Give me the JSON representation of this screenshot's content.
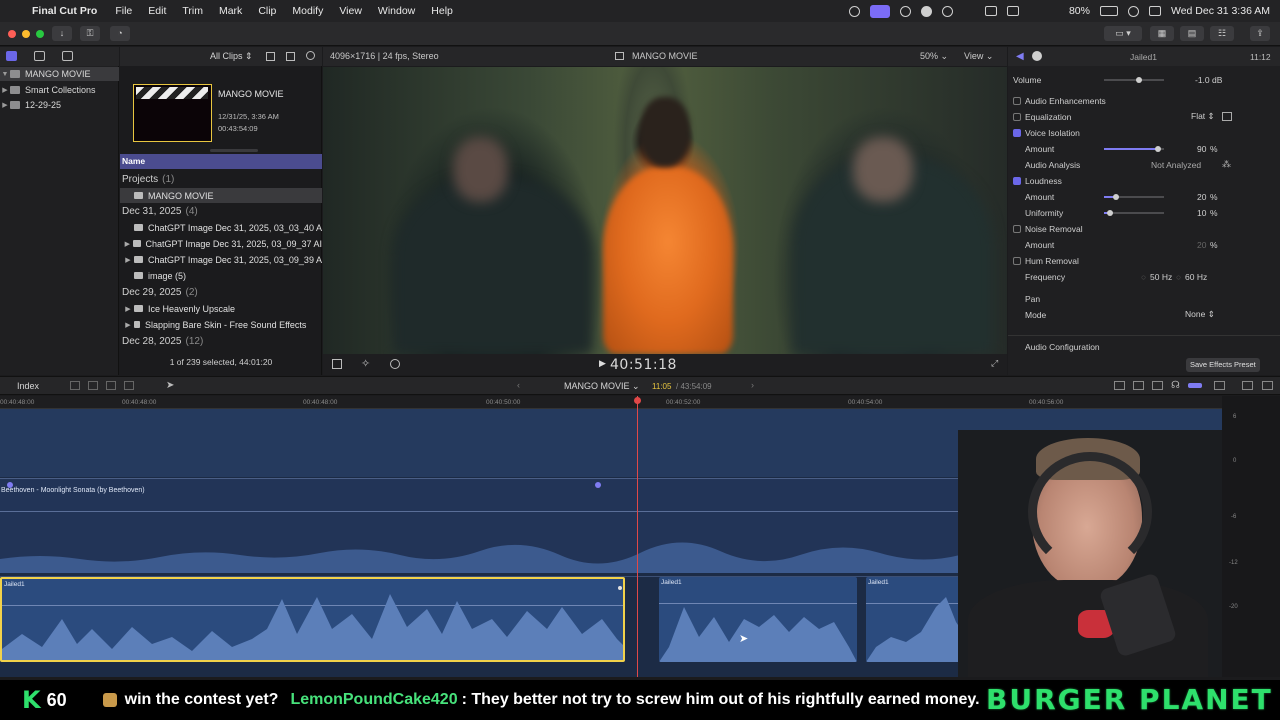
{
  "menubar": {
    "app_name": "Final Cut Pro",
    "items": [
      "File",
      "Edit",
      "Trim",
      "Mark",
      "Clip",
      "Modify",
      "View",
      "Window",
      "Help"
    ],
    "battery": "80%",
    "datetime": "Wed Dec 31  3:36 AM"
  },
  "browser": {
    "filter": "All Clips",
    "library": "MANGO MOVIE",
    "sidebar": [
      "MANGO MOVIE",
      "Smart Collections",
      "12-29-25"
    ],
    "preview": {
      "title": "MANGO MOVIE",
      "date": "12/31/25, 3:36 AM",
      "duration": "00:43:54:09"
    },
    "column_header": "Name",
    "rows": [
      {
        "type": "group",
        "label": "Projects",
        "count": "(1)"
      },
      {
        "type": "item",
        "label": "MANGO MOVIE",
        "selected": true
      },
      {
        "type": "group",
        "label": "Dec 31, 2025",
        "count": "(4)"
      },
      {
        "type": "item",
        "label": "ChatGPT Image Dec 31, 2025, 03_03_40 A"
      },
      {
        "type": "item",
        "label": "ChatGPT Image Dec 31, 2025, 03_09_37 AI",
        "expand": true
      },
      {
        "type": "item",
        "label": "ChatGPT Image Dec 31, 2025, 03_09_39 A",
        "expand": true
      },
      {
        "type": "item",
        "label": "image (5)"
      },
      {
        "type": "group",
        "label": "Dec 29, 2025",
        "count": "(2)"
      },
      {
        "type": "item",
        "label": "Ice Heavenly Upscale",
        "expand": true
      },
      {
        "type": "item",
        "label": "Slapping Bare Skin - Free Sound Effects",
        "expand": true
      },
      {
        "type": "group",
        "label": "Dec 28, 2025",
        "count": "(12)"
      }
    ],
    "status": "1 of 239 selected, 44:01:20"
  },
  "viewer": {
    "format": "4096×1716 | 24 fps, Stereo",
    "title": "MANGO MOVIE",
    "zoom": "50%",
    "view_label": "View",
    "timecode": "40:51:18"
  },
  "inspector": {
    "clip_name": "Jailed1",
    "duration": "11:12",
    "volume_label": "Volume",
    "volume_value": "-1.0  dB",
    "section": "Audio Enhancements",
    "rows": [
      {
        "label": "Equalization",
        "value": "Flat",
        "check": false
      },
      {
        "label": "Voice Isolation",
        "check": true
      },
      {
        "label": "Amount",
        "value": "90",
        "unit": "%",
        "indent": true,
        "level": 0.9
      },
      {
        "label": "Audio Analysis",
        "value": "Not Analyzed",
        "indent": true
      },
      {
        "label": "Loudness",
        "check": true
      },
      {
        "label": "Amount",
        "value": "20",
        "unit": "%",
        "indent": true,
        "level": 0.2
      },
      {
        "label": "Uniformity",
        "value": "10",
        "unit": "%",
        "indent": true,
        "level": 0.1
      },
      {
        "label": "Noise Removal",
        "check": false
      },
      {
        "label": "Amount",
        "value": "20",
        "unit": "%",
        "indent": true,
        "dim": true
      },
      {
        "label": "Hum Removal",
        "check": false
      },
      {
        "label": "Frequency",
        "value": "50 Hz",
        "value2": "60 Hz",
        "indent": true
      }
    ],
    "pan_label": "Pan",
    "mode_label": "Mode",
    "mode_value": "None",
    "audio_config": "Audio Configuration",
    "save_preset": "Save Effects Preset"
  },
  "timeline": {
    "index_label": "Index",
    "project": "MANGO MOVIE",
    "position": "11:05",
    "total": "/ 43:54:09",
    "ruler": [
      "00:40:48:00",
      "00:40:48:00",
      "00:40:50:00",
      "00:40:52:00",
      "00:40:54:00",
      "00:40:56:00"
    ],
    "music": "Beethoven - Moonlight Sonata (by Beethoven)",
    "clips": [
      "Jailed1",
      "Jailed1",
      "Jailed1"
    ],
    "meter_labels": [
      "6",
      "0",
      "-6",
      "-12",
      "-20"
    ]
  },
  "overlay": {
    "k": "K",
    "count": "60",
    "message1": "win the contest yet?",
    "user": "LemonPoundCake420",
    "message2": ": They better not try to screw him out of his rightfully earned money.",
    "brand": "BURGER PLANET"
  },
  "colors": {
    "accent": "#6b67e8",
    "selection_yellow": "#f2d24a",
    "playhead": "#e04848",
    "overlay_green": "#2ee06c"
  }
}
